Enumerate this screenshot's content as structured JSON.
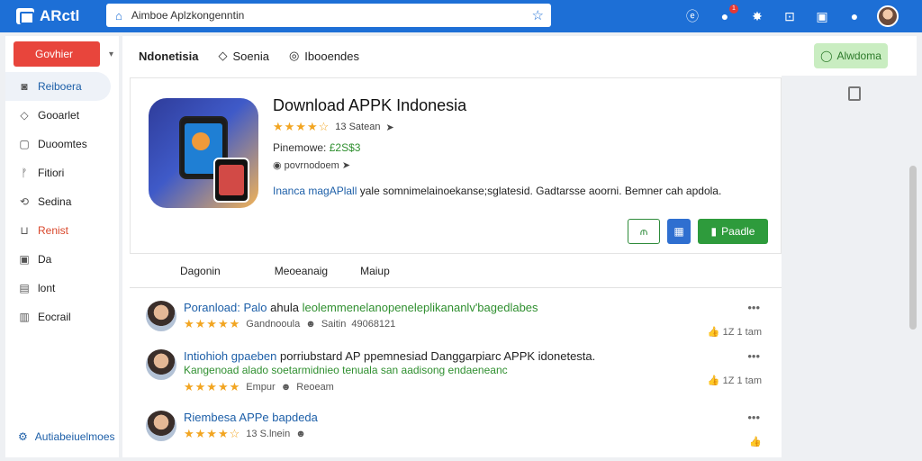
{
  "app": {
    "brand": "ARctl"
  },
  "search": {
    "text": "Aimboe Aplzkongenntin"
  },
  "topbar": {
    "notif_count": "1"
  },
  "sidebar": {
    "primary_button": "Govhier",
    "items": [
      {
        "label": "Reiboera",
        "icon": "home-icon",
        "active": true
      },
      {
        "label": "Gooarlet",
        "icon": "bookmark-icon"
      },
      {
        "label": "Duoomtes",
        "icon": "folder-icon"
      },
      {
        "label": "Fitiori",
        "icon": "filter-icon"
      },
      {
        "label": "Sedina",
        "icon": "refresh-icon"
      },
      {
        "label": "Renist",
        "icon": "tag-icon",
        "red": true
      },
      {
        "label": "Da",
        "icon": "calendar-icon"
      },
      {
        "label": "lont",
        "icon": "list-icon"
      },
      {
        "label": "Eocrail",
        "icon": "mail-icon"
      }
    ],
    "footer": "Autiabeiuelmoes"
  },
  "toolbar": {
    "title": "Ndonetisia",
    "item2": "Soenia",
    "item3": "Ibooendes",
    "action_button": "Alwdoma"
  },
  "appcard": {
    "title": "Download APPK Indonesia",
    "rating": 4.5,
    "rating_text": "13 Satean",
    "price_label": "Pinemowe:",
    "price_value": "£2S$3",
    "dev": "povrnodoem",
    "desc_link": "Inanca magAPlall",
    "desc_text": "yale somnimelainoekanse;sglatesid. Gadtarsse aoorni. Bemner cah apdola.",
    "install_label": "Paadle"
  },
  "tabs": [
    "Dagonin",
    "Meoeanaig",
    "Maiup"
  ],
  "reviews": [
    {
      "name": "Poranload: Palo",
      "k": "ahula",
      "g": "leolemmenelanopeneleplikananlv'bagedlabes",
      "stars": "★★★★★",
      "meta1": "Gandnooula",
      "meta2": "Saitin",
      "meta3": "49068121",
      "likes": "1Z 1 tam",
      "rating": 5
    },
    {
      "name": "Intiohioh gpaeben",
      "k": "porriubstard AP ppemnesiad Danggarpiarc APPK idonetesta.",
      "g": "Kangenoad alado soetarmidnieo tenuala san aadisong endaeneanc",
      "stars": "★★★★★",
      "meta1": "Empur",
      "meta2": "Reoeam",
      "meta3": "",
      "likes": "1Z 1 tam",
      "rating": 4.5
    },
    {
      "name": "Riembesa APPe bapdeda",
      "k": "",
      "g": "",
      "stars": "★★★★★",
      "meta1": "13 S.lnein",
      "meta2": "",
      "meta3": "",
      "likes": "",
      "rating": 4
    }
  ]
}
